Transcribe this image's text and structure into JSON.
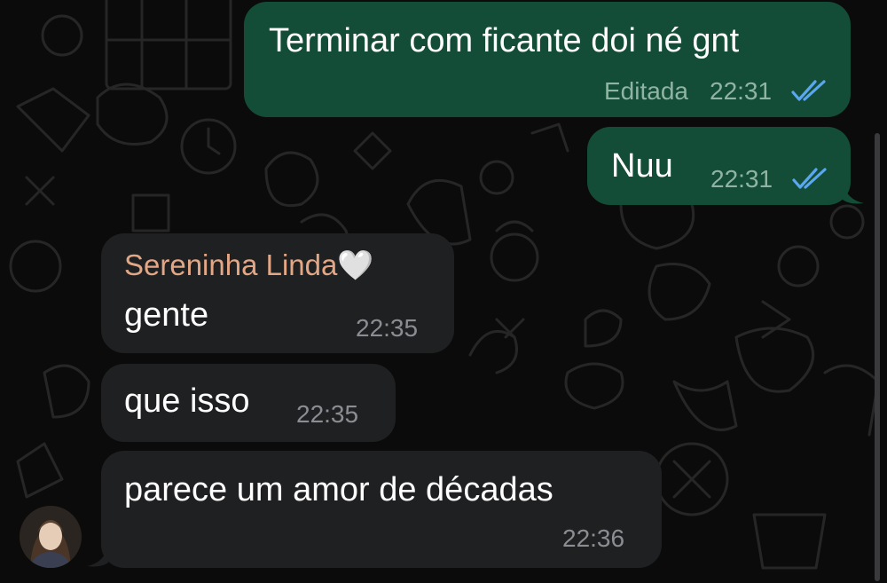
{
  "colors": {
    "outgoing_bubble": "#144d37",
    "incoming_bubble": "#1f2022",
    "sender_name": "#e3a786",
    "read_ticks": "#5aa7ef",
    "background": "#0b0b0b"
  },
  "messages": [
    {
      "direction": "outgoing",
      "text": "Terminar com ficante doi né gnt",
      "edited_label": "Editada",
      "time": "22:31",
      "status_icon": "double-check-read-icon"
    },
    {
      "direction": "outgoing",
      "text": "Nuu",
      "time": "22:31",
      "status_icon": "double-check-read-icon"
    },
    {
      "direction": "incoming",
      "sender": "Sereninha Linda🤍",
      "text": "gente",
      "time": "22:35"
    },
    {
      "direction": "incoming",
      "text": "que isso",
      "time": "22:35"
    },
    {
      "direction": "incoming",
      "text": "parece um amor de décadas",
      "time": "22:36",
      "avatar_icon": "contact-avatar"
    }
  ]
}
